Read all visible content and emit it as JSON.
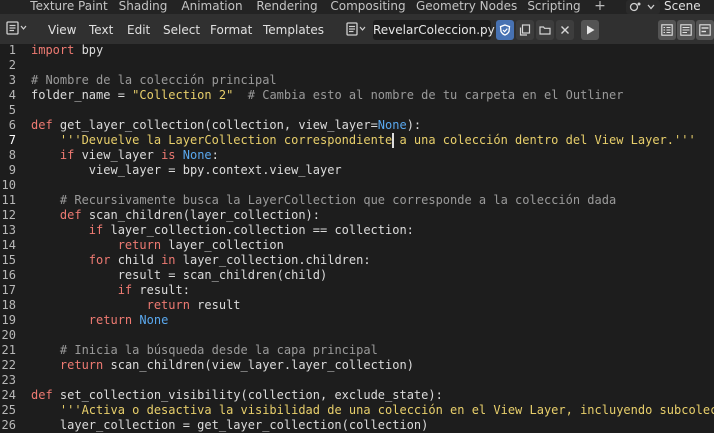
{
  "workspace_tabs": [
    {
      "label": "Texture Paint",
      "active": false
    },
    {
      "label": "Shading",
      "active": false
    },
    {
      "label": "Animation",
      "active": false
    },
    {
      "label": "Rendering",
      "active": false
    },
    {
      "label": "Compositing",
      "active": false
    },
    {
      "label": "Geometry Nodes",
      "active": false
    },
    {
      "label": "Scripting",
      "active": true
    }
  ],
  "add_workspace": "+",
  "scene_name": "Scene",
  "menus": [
    "View",
    "Text",
    "Edit",
    "Select",
    "Format",
    "Templates"
  ],
  "text_block": {
    "name": "RevelarColeccion.py"
  },
  "current_line": 7,
  "colors": {
    "keyword": "#ee7a72",
    "builtin": "#5aa8ee",
    "string": "#e8cf6b",
    "comment": "#9a9a9a",
    "text": "#dcdcdc",
    "background": "#1d1d1d",
    "header": "#303030",
    "active_tab": "#444444"
  },
  "code_lines": [
    {
      "n": "1",
      "tokens": [
        {
          "t": "import",
          "c": "kw"
        },
        {
          "t": " bpy",
          "c": "id"
        }
      ]
    },
    {
      "n": "2",
      "tokens": []
    },
    {
      "n": "3",
      "tokens": [
        {
          "t": "# Nombre de la colección principal",
          "c": "cm"
        }
      ]
    },
    {
      "n": "4",
      "tokens": [
        {
          "t": "folder_name = ",
          "c": "id"
        },
        {
          "t": "\"Collection 2\"",
          "c": "st"
        },
        {
          "t": "  ",
          "c": "id"
        },
        {
          "t": "# Cambia esto al nombre de tu carpeta en el Outliner",
          "c": "cm"
        }
      ]
    },
    {
      "n": "5",
      "tokens": []
    },
    {
      "n": "6",
      "tokens": [
        {
          "t": "def",
          "c": "kw"
        },
        {
          "t": " get_layer_collection(collection, view_layer=",
          "c": "id"
        },
        {
          "t": "None",
          "c": "bi"
        },
        {
          "t": "):",
          "c": "id"
        }
      ]
    },
    {
      "n": "7",
      "tokens": [
        {
          "t": "    ",
          "c": "id"
        },
        {
          "t": "'''Devuelve la LayerCollection correspondiente a una colección dentro del View Layer.'''",
          "c": "st"
        }
      ]
    },
    {
      "n": "8",
      "tokens": [
        {
          "t": "    ",
          "c": "id"
        },
        {
          "t": "if",
          "c": "kw"
        },
        {
          "t": " view_layer ",
          "c": "id"
        },
        {
          "t": "is",
          "c": "kw"
        },
        {
          "t": " ",
          "c": "id"
        },
        {
          "t": "None",
          "c": "bi"
        },
        {
          "t": ":",
          "c": "id"
        }
      ]
    },
    {
      "n": "9",
      "tokens": [
        {
          "t": "        view_layer = bpy.context.view_layer",
          "c": "id"
        }
      ]
    },
    {
      "n": "10",
      "tokens": []
    },
    {
      "n": "11",
      "tokens": [
        {
          "t": "    ",
          "c": "id"
        },
        {
          "t": "# Recursivamente busca la LayerCollection que corresponde a la colección dada",
          "c": "cm"
        }
      ]
    },
    {
      "n": "12",
      "tokens": [
        {
          "t": "    ",
          "c": "id"
        },
        {
          "t": "def",
          "c": "kw"
        },
        {
          "t": " scan_children(layer_collection):",
          "c": "id"
        }
      ]
    },
    {
      "n": "13",
      "tokens": [
        {
          "t": "        ",
          "c": "id"
        },
        {
          "t": "if",
          "c": "kw"
        },
        {
          "t": " layer_collection.collection == collection:",
          "c": "id"
        }
      ]
    },
    {
      "n": "14",
      "tokens": [
        {
          "t": "            ",
          "c": "id"
        },
        {
          "t": "return",
          "c": "kw"
        },
        {
          "t": " layer_collection",
          "c": "id"
        }
      ]
    },
    {
      "n": "15",
      "tokens": [
        {
          "t": "        ",
          "c": "id"
        },
        {
          "t": "for",
          "c": "kw"
        },
        {
          "t": " child ",
          "c": "id"
        },
        {
          "t": "in",
          "c": "kw"
        },
        {
          "t": " layer_collection.children:",
          "c": "id"
        }
      ]
    },
    {
      "n": "16",
      "tokens": [
        {
          "t": "            result = scan_children(child)",
          "c": "id"
        }
      ]
    },
    {
      "n": "17",
      "tokens": [
        {
          "t": "            ",
          "c": "id"
        },
        {
          "t": "if",
          "c": "kw"
        },
        {
          "t": " result:",
          "c": "id"
        }
      ]
    },
    {
      "n": "18",
      "tokens": [
        {
          "t": "                ",
          "c": "id"
        },
        {
          "t": "return",
          "c": "kw"
        },
        {
          "t": " result",
          "c": "id"
        }
      ]
    },
    {
      "n": "19",
      "tokens": [
        {
          "t": "        ",
          "c": "id"
        },
        {
          "t": "return",
          "c": "kw"
        },
        {
          "t": " ",
          "c": "id"
        },
        {
          "t": "None",
          "c": "bi"
        }
      ]
    },
    {
      "n": "20",
      "tokens": []
    },
    {
      "n": "21",
      "tokens": [
        {
          "t": "    ",
          "c": "id"
        },
        {
          "t": "# Inicia la búsqueda desde la capa principal",
          "c": "cm"
        }
      ]
    },
    {
      "n": "22",
      "tokens": [
        {
          "t": "    ",
          "c": "id"
        },
        {
          "t": "return",
          "c": "kw"
        },
        {
          "t": " scan_children(view_layer.layer_collection)",
          "c": "id"
        }
      ]
    },
    {
      "n": "23",
      "tokens": []
    },
    {
      "n": "24",
      "tokens": [
        {
          "t": "def",
          "c": "kw"
        },
        {
          "t": " set_collection_visibility(collection, exclude_state):",
          "c": "id"
        }
      ]
    },
    {
      "n": "25",
      "tokens": [
        {
          "t": "    ",
          "c": "id"
        },
        {
          "t": "'''Activa o desactiva la visibilidad de una colección en el View Layer, incluyendo subcolecciones.'''",
          "c": "st"
        }
      ]
    },
    {
      "n": "26",
      "tokens": [
        {
          "t": "    layer_collection = get_layer_collection(collection)",
          "c": "id"
        }
      ]
    }
  ]
}
